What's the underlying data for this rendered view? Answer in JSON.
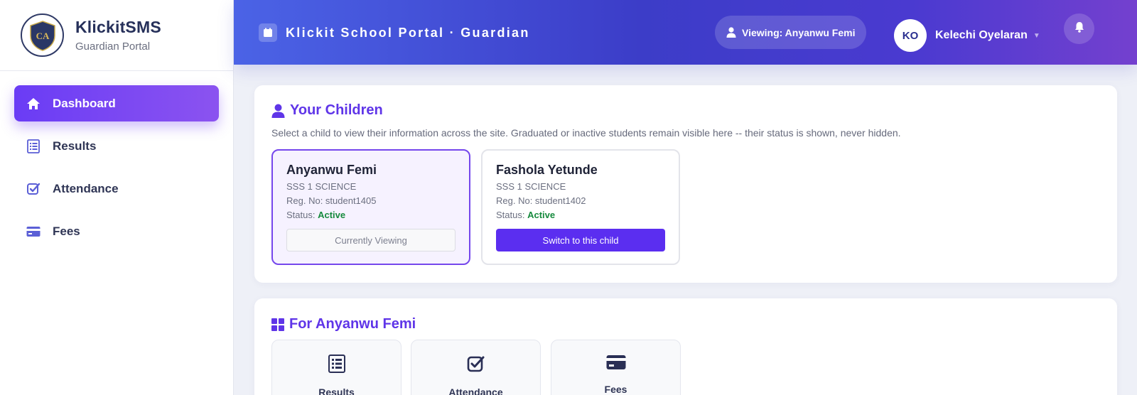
{
  "brand": {
    "logo_text": "CA",
    "name": "KlickitSMS",
    "subtitle": "Guardian Portal"
  },
  "sidebar": {
    "items": [
      {
        "label": "Dashboard",
        "icon": "home-icon",
        "active": true
      },
      {
        "label": "Results",
        "icon": "list-icon",
        "active": false
      },
      {
        "label": "Attendance",
        "icon": "check-square-icon",
        "active": false
      },
      {
        "label": "Fees",
        "icon": "credit-card-icon",
        "active": false
      }
    ]
  },
  "header": {
    "title": "Klickit School Portal · Guardian",
    "viewing": "Viewing: Anyanwu Femi",
    "user_initials": "KO",
    "user_name": "Kelechi Oyelaran"
  },
  "children_section": {
    "title": "Your Children",
    "description": "Select a child to view their information across the site. Graduated or inactive students remain visible here -- their status is shown, never hidden.",
    "children": [
      {
        "name": "Anyanwu Femi",
        "class": "SSS 1 SCIENCE",
        "reg": "Reg. No: student1405",
        "status_label": "Status: ",
        "status": "Active",
        "button": "Currently Viewing",
        "selected": true
      },
      {
        "name": "Fashola Yetunde",
        "class": "SSS 1 SCIENCE",
        "reg": "Reg. No: student1402",
        "status_label": "Status: ",
        "status": "Active",
        "button": "Switch to this child",
        "selected": false
      }
    ]
  },
  "for_section": {
    "title": "For Anyanwu Femi",
    "tiles": [
      {
        "label": "Results",
        "icon": "list-icon"
      },
      {
        "label": "Attendance",
        "icon": "check-square-icon"
      },
      {
        "label": "Fees",
        "icon": "credit-card-icon"
      }
    ]
  },
  "colors": {
    "accent": "#5f35e8",
    "header_start": "#4b63e6",
    "header_end": "#7440cf",
    "active_status": "#168a3d"
  }
}
